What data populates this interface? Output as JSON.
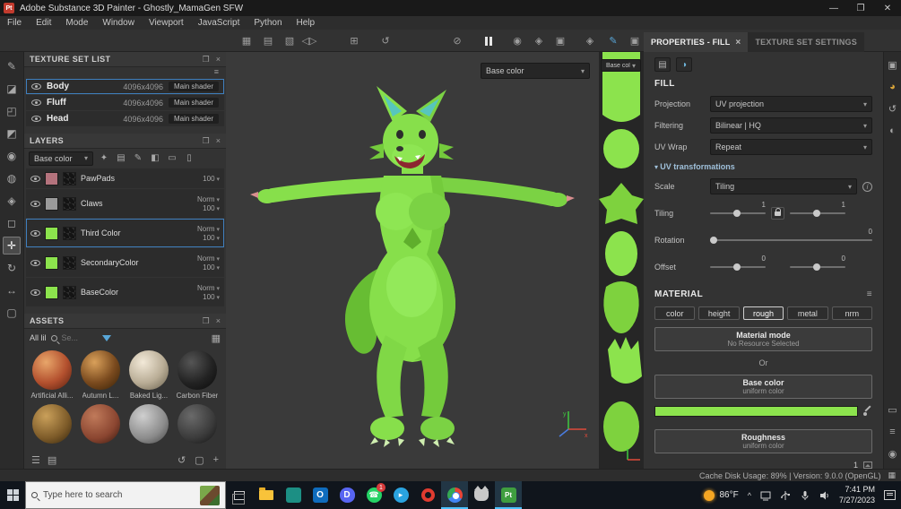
{
  "window": {
    "icon_label": "Pt",
    "title": "Adobe Substance 3D Painter - Ghostly_MamaGen SFW",
    "minimize": "—",
    "maximize": "❐",
    "close": "✕"
  },
  "menu": {
    "items": [
      "File",
      "Edit",
      "Mode",
      "Window",
      "Viewport",
      "JavaScript",
      "Python",
      "Help"
    ]
  },
  "icons": {
    "grid_a": "▦",
    "grid_b": "▤",
    "grid_c": "▧",
    "symmetry": "◁▷",
    "add": "⊞",
    "history": "↺",
    "no_overlay": "⊘",
    "spray": "◉",
    "gun": "◈",
    "camera_tool": "▣",
    "pencil": "✎",
    "camera": "▣",
    "float": "❐",
    "close": "×",
    "hamburger": "≡",
    "wrench": "✦",
    "add_layer": "▤",
    "paint": "✎",
    "fill": "◧",
    "folder": "▭",
    "trash": "▯",
    "fill_props": "▤",
    "shader_ball": "◑",
    "list_a": "☰",
    "list_b": "▤",
    "refresh": "↺",
    "export": "▢",
    "plus": "+",
    "rs_camera": "▣",
    "rs_sphere": "◕",
    "rs_history": "↺",
    "rs_shader": "◐",
    "rs_display": "▭",
    "rs_sliders": "≡",
    "rs_info": "◉",
    "status_grid": "▦"
  },
  "tools": {
    "t0": {
      "glyph": "✎"
    },
    "t1": {
      "glyph": "◪"
    },
    "t2": {
      "glyph": "◰"
    },
    "t3": {
      "glyph": "◩"
    },
    "t4": {
      "glyph": "◉"
    },
    "t5": {
      "glyph": "◍"
    },
    "t6": {
      "glyph": "◈"
    },
    "t7": {
      "glyph": "◻"
    },
    "t8": {
      "glyph": "✛"
    },
    "t9": {
      "glyph": "↻"
    },
    "t10": {
      "glyph": "↔"
    },
    "t11": {
      "glyph": "▢"
    }
  },
  "texture_set_list": {
    "title": "TEXTURE SET LIST",
    "rows": [
      {
        "name": "Body",
        "size": "4096x4096",
        "shader": "Main shader"
      },
      {
        "name": "Fluff",
        "size": "4096x4096",
        "shader": "Main shader"
      },
      {
        "name": "Head",
        "size": "4096x4096",
        "shader": "Main shader"
      }
    ]
  },
  "layers": {
    "title": "LAYERS",
    "channel": "Base color",
    "items": [
      {
        "name": "PawPads",
        "blend": "",
        "opacity": "100"
      },
      {
        "name": "Claws",
        "blend": "Norm",
        "opacity": "100"
      },
      {
        "name": "Third Color",
        "blend": "Norm",
        "opacity": "100"
      },
      {
        "name": "SecondaryColor",
        "blend": "Norm",
        "opacity": "100"
      },
      {
        "name": "BaseColor",
        "blend": "Norm",
        "opacity": "100"
      }
    ]
  },
  "assets": {
    "title": "ASSETS",
    "library_label": "All lil",
    "search_placeholder": "Se...",
    "items": [
      "Artificial Alli...",
      "Autumn L...",
      "Baked Lig...",
      "Carbon Fiber"
    ]
  },
  "viewport": {
    "channel": "Base color",
    "axis_x": "x",
    "axis_y": "y"
  },
  "view2d": {
    "channel": "Base col..."
  },
  "properties": {
    "tab_fill": "PROPERTIES - FILL",
    "tab_texture_set": "TEXTURE SET SETTINGS",
    "tab_close": "×",
    "fill": {
      "title": "FILL",
      "projection_label": "Projection",
      "projection_value": "UV projection",
      "filtering_label": "Filtering",
      "filtering_value": "Bilinear | HQ",
      "uv_wrap_label": "UV Wrap",
      "uv_wrap_value": "Repeat",
      "uv_transformations": "UV transformations",
      "scale_label": "Scale",
      "scale_value": "Tiling",
      "info": "i",
      "tiling_label": "Tiling",
      "tiling_value1": "1",
      "tiling_value2": "1",
      "rotation_label": "Rotation",
      "rotation_value": "0",
      "offset_label": "Offset",
      "offset_value1": "0",
      "offset_value2": "0"
    },
    "material": {
      "title": "MATERIAL",
      "channels": {
        "c0": "color",
        "c1": "height",
        "c2": "rough",
        "c3": "metal",
        "c4": "nrm"
      },
      "material_mode_label": "Material mode",
      "material_mode_value": "No Resource Selected",
      "or_label": "Or",
      "base_color_label": "Base color",
      "base_color_value": "uniform color",
      "base_color_hex": "#8ce34d",
      "roughness_label": "Roughness",
      "roughness_value": "uniform color",
      "roughness_amount": "1"
    }
  },
  "status_bar": {
    "text": "Cache Disk Usage:  89% | Version: 9.0.0 (OpenGL)"
  },
  "taskbar": {
    "search_placeholder": "Type here to search",
    "outlook_letter": "O",
    "discord_letter": "D",
    "whatsapp_glyph": "☎",
    "whatsapp_badge": "1",
    "telegram_glyph": "▸",
    "painter_label": "Pt",
    "weather_temp": "86°F",
    "chevron_up": "^",
    "time": "7:41 PM",
    "date": "7/27/2023"
  }
}
